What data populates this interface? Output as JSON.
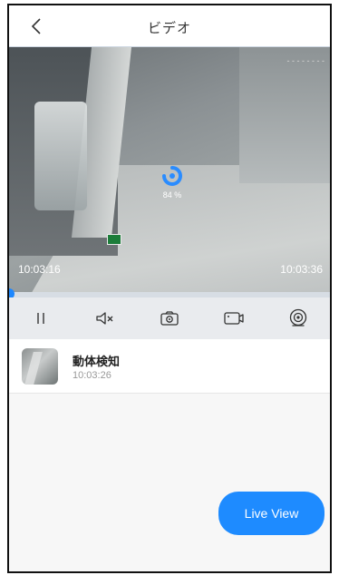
{
  "header": {
    "title": "ビデオ",
    "back_icon": "chevron-left-icon"
  },
  "video": {
    "watermark": "- - - - - - - -",
    "loading_percent": "84 %",
    "time_start": "10:03:16",
    "time_end": "10:03:36",
    "progress_fraction": 0.0
  },
  "controls": [
    {
      "name": "pause",
      "icon": "pause-icon"
    },
    {
      "name": "mute",
      "icon": "mute-icon"
    },
    {
      "name": "screenshot",
      "icon": "camera-icon"
    },
    {
      "name": "record",
      "icon": "record-icon"
    },
    {
      "name": "ptz",
      "icon": "lens-icon"
    }
  ],
  "event": {
    "title": "動体検知",
    "time": "10:03:26"
  },
  "live_view": {
    "label": "Live View"
  },
  "colors": {
    "accent": "#1e88ff",
    "control_bar": "#e9ebee",
    "progress_track": "#d7dde4"
  }
}
